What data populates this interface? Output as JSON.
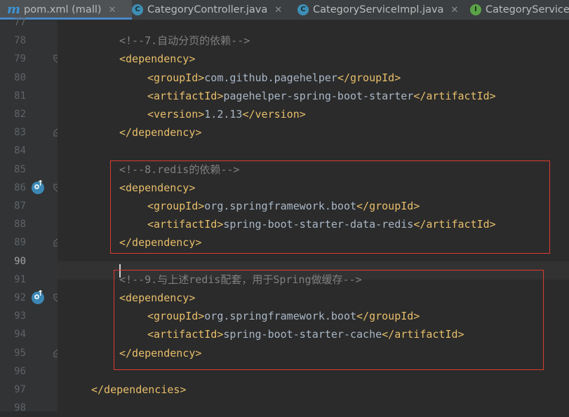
{
  "tabs": [
    {
      "label": "pom.xml (mall)",
      "icon": "maven-icon",
      "active": true,
      "closable": true
    },
    {
      "label": "CategoryController.java",
      "icon": "class-icon",
      "active": false,
      "closable": true
    },
    {
      "label": "CategoryServiceImpl.java",
      "icon": "class-icon",
      "active": false,
      "closable": true
    },
    {
      "label": "CategoryService",
      "icon": "interface-icon",
      "active": false,
      "closable": false
    }
  ],
  "colors": {
    "tag": "#e8bf6a",
    "comment": "#808080",
    "text": "#a9b7c6",
    "highlight_box": "#dd3b33"
  },
  "current_line": "90",
  "lines": [
    {
      "num": "77",
      "indent": 0,
      "tokens": []
    },
    {
      "num": "78",
      "indent": 8,
      "tokens": [
        [
          "cmt",
          "<!--7.自动分页的依赖-->"
        ]
      ]
    },
    {
      "num": "79",
      "indent": 8,
      "tokens": [
        [
          "tag",
          "<dependency>"
        ]
      ]
    },
    {
      "num": "80",
      "indent": 12,
      "tokens": [
        [
          "tag",
          "<groupId>"
        ],
        [
          "txt",
          "com.github.pagehelper"
        ],
        [
          "tag",
          "</groupId>"
        ]
      ]
    },
    {
      "num": "81",
      "indent": 12,
      "tokens": [
        [
          "tag",
          "<artifactId>"
        ],
        [
          "txt",
          "pagehelper-spring-boot-starter"
        ],
        [
          "tag",
          "</artifactId>"
        ]
      ]
    },
    {
      "num": "82",
      "indent": 12,
      "tokens": [
        [
          "tag",
          "<version>"
        ],
        [
          "txt",
          "1.2.13"
        ],
        [
          "tag",
          "</version>"
        ]
      ]
    },
    {
      "num": "83",
      "indent": 8,
      "tokens": [
        [
          "tag",
          "</dependency>"
        ]
      ]
    },
    {
      "num": "84",
      "indent": 0,
      "tokens": []
    },
    {
      "num": "85",
      "indent": 8,
      "tokens": [
        [
          "cmt",
          "<!--8.redis的依赖-->"
        ]
      ]
    },
    {
      "num": "86",
      "indent": 8,
      "tokens": [
        [
          "tag",
          "<dependency>"
        ]
      ]
    },
    {
      "num": "87",
      "indent": 12,
      "tokens": [
        [
          "tag",
          "<groupId>"
        ],
        [
          "txt",
          "org.springframework.boot"
        ],
        [
          "tag",
          "</groupId>"
        ]
      ]
    },
    {
      "num": "88",
      "indent": 12,
      "tokens": [
        [
          "tag",
          "<artifactId>"
        ],
        [
          "txt",
          "spring-boot-starter-data-redis"
        ],
        [
          "tag",
          "</artifactId>"
        ]
      ]
    },
    {
      "num": "89",
      "indent": 8,
      "tokens": [
        [
          "tag",
          "</dependency>"
        ]
      ]
    },
    {
      "num": "90",
      "indent": 0,
      "tokens": []
    },
    {
      "num": "91",
      "indent": 8,
      "tokens": [
        [
          "cmt",
          "<!--9.与上述redis配套，用于Spring做缓存-->"
        ]
      ]
    },
    {
      "num": "92",
      "indent": 8,
      "tokens": [
        [
          "tag",
          "<dependency>"
        ]
      ]
    },
    {
      "num": "93",
      "indent": 12,
      "tokens": [
        [
          "tag",
          "<groupId>"
        ],
        [
          "txt",
          "org.springframework.boot"
        ],
        [
          "tag",
          "</groupId>"
        ]
      ]
    },
    {
      "num": "94",
      "indent": 12,
      "tokens": [
        [
          "tag",
          "<artifactId>"
        ],
        [
          "txt",
          "spring-boot-starter-cache"
        ],
        [
          "tag",
          "</artifactId>"
        ]
      ]
    },
    {
      "num": "95",
      "indent": 8,
      "tokens": [
        [
          "tag",
          "</dependency>"
        ]
      ]
    },
    {
      "num": "96",
      "indent": 0,
      "tokens": []
    },
    {
      "num": "97",
      "indent": 4,
      "tokens": [
        [
          "tag",
          "</dependencies>"
        ]
      ]
    },
    {
      "num": "98",
      "indent": 0,
      "tokens": []
    }
  ],
  "gutter_icons": [
    {
      "line": "86",
      "icon": "maven-dependency-icon"
    },
    {
      "line": "92",
      "icon": "maven-dependency-icon"
    }
  ],
  "fold_markers": [
    {
      "line": "79",
      "kind": "open"
    },
    {
      "line": "83",
      "kind": "close"
    },
    {
      "line": "86",
      "kind": "open"
    },
    {
      "line": "89",
      "kind": "close"
    },
    {
      "line": "92",
      "kind": "open"
    },
    {
      "line": "95",
      "kind": "close"
    }
  ]
}
